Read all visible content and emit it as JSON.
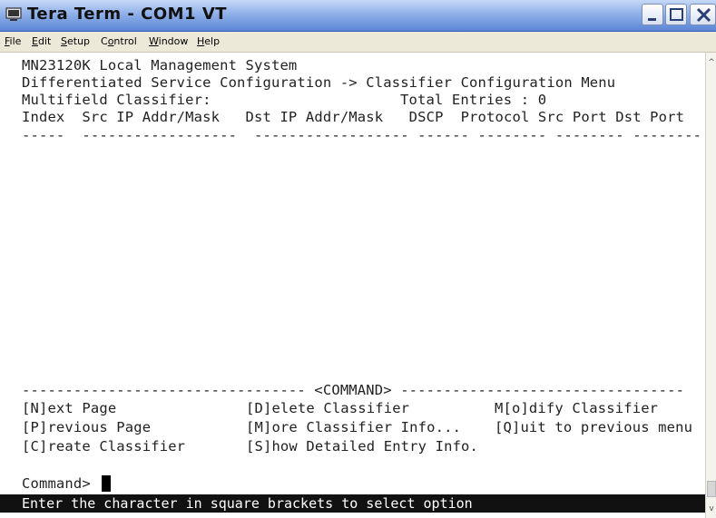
{
  "window": {
    "title": "Tera Term - COM1 VT",
    "app_icon": "terminal-icon",
    "buttons": [
      "minimize-icon",
      "maximize-icon",
      "close-icon"
    ]
  },
  "menu": [
    {
      "label": "File",
      "accel": "F",
      "rest": "ile"
    },
    {
      "label": "Edit",
      "accel": "E",
      "rest": "dit"
    },
    {
      "label": "Setup",
      "accel": "S",
      "rest": "etup"
    },
    {
      "label": "Control",
      "pre": "C",
      "accel": "o",
      "rest": "ntrol"
    },
    {
      "label": "Window",
      "accel": "W",
      "rest": "indow"
    },
    {
      "label": "Help",
      "accel": "H",
      "rest": "elp"
    }
  ],
  "terminal": {
    "header": "MN23120K Local Management System",
    "breadcrumb": "Differentiated Service Configuration -> Classifier Configuration Menu",
    "section_title": "Multifield Classifier:",
    "total_entries": "Total Entries : 0",
    "columns_line": "Index  Src IP Addr/Mask   Dst IP Addr/Mask   DSCP  Protocol Src Port Dst Port",
    "divider_line": "-----  ------------------  ------------------ ------ -------- -------- --------",
    "command_banner": "--------------------------------- <COMMAND> ---------------------------------",
    "commands": [
      [
        "[N]ext Page",
        "[D]elete Classifier",
        "M[o]dify Classifier"
      ],
      [
        "[P]revious Page",
        "[M]ore Classifier Info...",
        "[Q]uit to previous menu"
      ],
      [
        "[C]reate Classifier",
        "[S]how Detailed Entry Info.",
        ""
      ]
    ],
    "prompt": "Command>",
    "status": "Enter the character in square brackets to select option"
  }
}
